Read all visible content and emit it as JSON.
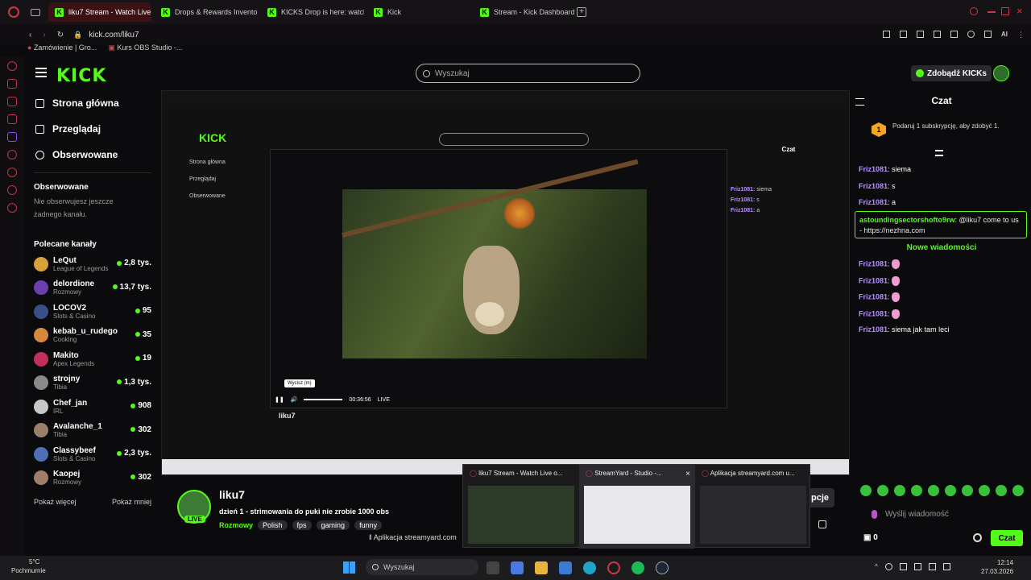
{
  "browser": {
    "tabs": [
      {
        "label": "liku7 Stream - Watch Live"
      },
      {
        "label": "Drops & Rewards Inventor"
      },
      {
        "label": "KICKS Drop is here: watch"
      },
      {
        "label": "Kick"
      },
      {
        "label": "Stream - Kick Dashboard"
      }
    ],
    "url": "kick.com/liku7",
    "bookmarks": [
      {
        "label": "Zamówienie | Gro..."
      },
      {
        "label": "Kurs OBS Studio -..."
      }
    ]
  },
  "header": {
    "logo": "KICK",
    "search_placeholder": "Wyszukaj",
    "get_kicks": "Zdobądź KICKs"
  },
  "sidebar": {
    "nav": [
      {
        "label": "Strona główna"
      },
      {
        "label": "Przeglądaj"
      },
      {
        "label": "Obserwowane"
      }
    ],
    "following_title": "Obserwowane",
    "following_empty": "Nie obserwujesz jeszcze żadnego kanału.",
    "recommended_title": "Polecane kanały",
    "channels": [
      {
        "name": "LeQut",
        "category": "League of Legends",
        "count": "2,8 tys.",
        "color": "#d6a13a"
      },
      {
        "name": "delordione",
        "category": "Rozmowy",
        "count": "13,7 tys.",
        "color": "#6b3fb0"
      },
      {
        "name": "LOCOV2",
        "category": "Slots & Casino",
        "count": "95",
        "color": "#3a4f8a"
      },
      {
        "name": "kebab_u_rudego",
        "category": "Cooking",
        "count": "35",
        "color": "#d98840"
      },
      {
        "name": "Makito",
        "category": "Apex Legends",
        "count": "19",
        "color": "#c0305a"
      },
      {
        "name": "strojny",
        "category": "Tibia",
        "count": "1,3 tys.",
        "color": "#8a8a8a"
      },
      {
        "name": "Chef_jan",
        "category": "IRL",
        "count": "908",
        "color": "#c7c7c7"
      },
      {
        "name": "Avalanche_1",
        "category": "Tibia",
        "count": "302",
        "color": "#9a7f6a"
      },
      {
        "name": "Classybeef",
        "category": "Slots & Casino",
        "count": "2,3 tys.",
        "color": "#4d6fb8"
      },
      {
        "name": "Kaopej",
        "category": "Rozmowy",
        "count": "302",
        "color": "#a07d68"
      }
    ],
    "show_more": "Pokaż więcej",
    "show_less": "Pokaż mniej"
  },
  "player": {
    "tooltip": "Wycisz (m)",
    "time": "00:36:56",
    "live": "LIVE"
  },
  "stream": {
    "name": "liku7",
    "title": "dzień 1 - strimowania do puki nie zrobie 1000 obs",
    "category": "Rozmowy",
    "tags": [
      "Polish",
      "fps",
      "gaming",
      "funny"
    ],
    "subscribe_partial": "pcje"
  },
  "chat": {
    "title": "Czat",
    "goal": "Podaruj 1 subskrypcję, aby zdobyć 1.",
    "goal_num": "1",
    "messages_top": [
      {
        "user": "Friz1081",
        "text": "siema"
      },
      {
        "user": "Friz1081",
        "text": "s"
      },
      {
        "user": "Friz1081",
        "text": "a"
      }
    ],
    "highlight": {
      "user": "astoundingsectorshofto9rw",
      "text": "@liku7 come to us - https://nezhna.com"
    },
    "new_messages": "Nowe wiadomości",
    "messages_bottom": [
      {
        "user": "Friz1081",
        "text": ""
      },
      {
        "user": "Friz1081",
        "text": ""
      },
      {
        "user": "Friz1081",
        "text": ""
      },
      {
        "user": "Friz1081",
        "text": ""
      },
      {
        "user": "Friz1081",
        "text": "siema jak tam leci"
      }
    ],
    "input_placeholder": "Wyślij wiadomość",
    "cart_count": "0",
    "send": "Czat"
  },
  "thumbs": [
    {
      "label": "liku7 Stream - Watch Live o..."
    },
    {
      "label": "StreamYard - Studio -..."
    },
    {
      "label": "Aplikacja streamyard.com u..."
    }
  ],
  "streamyard_bar": "Aplikacja streamyard.com",
  "taskbar": {
    "search": "Wyszukaj",
    "weather_temp": "5°C",
    "weather_text": "Pochmurnie",
    "time": "12:14",
    "date": "27.03.2026"
  }
}
